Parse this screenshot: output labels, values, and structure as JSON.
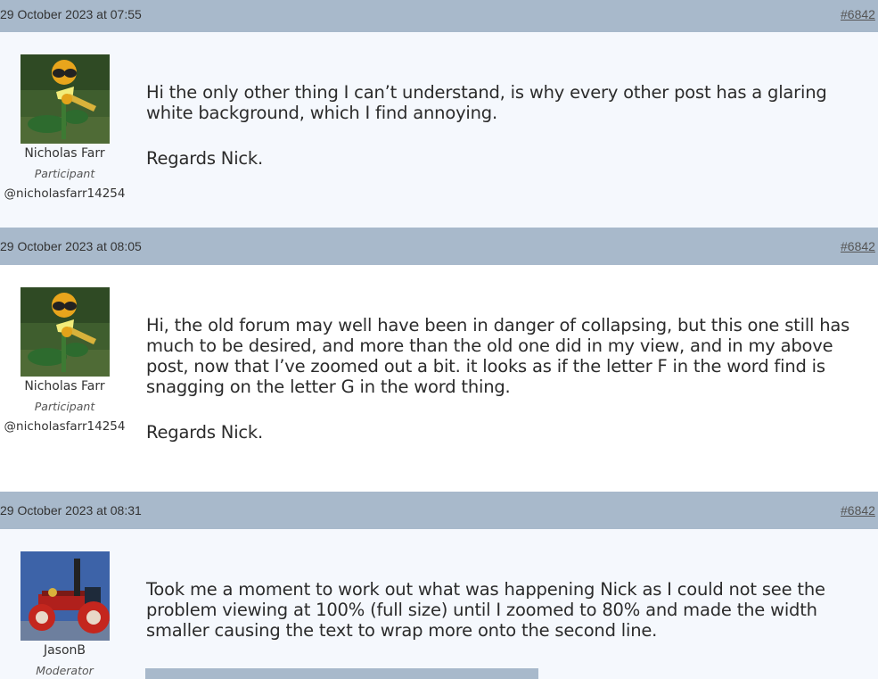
{
  "posts": [
    {
      "date": "29 October 2023 at 07:55",
      "permalink": "#6842",
      "author": {
        "name": "Nicholas Farr",
        "role": "Participant",
        "handle": "@nicholasfarr14254",
        "avatar_icon": "sunflower-avatar"
      },
      "paragraphs": [
        "Hi the only other thing I can’t understand, is why every other post has a glaring white background, which I find annoying.",
        "Regards Nick."
      ]
    },
    {
      "date": "29 October 2023 at 08:05",
      "permalink": "#6842",
      "author": {
        "name": "Nicholas Farr",
        "role": "Participant",
        "handle": "@nicholasfarr14254",
        "avatar_icon": "sunflower-avatar"
      },
      "paragraphs": [
        "Hi, the old forum may well have been in danger of collapsing, but this one still has much to be desired, and more than the old one did in my view, and in my above post, now that I’ve zoomed out a bit. it looks as if the letter F in the word find is snagging on the letter G in the word thing.",
        "Regards Nick."
      ]
    },
    {
      "date": "29 October 2023 at 08:31",
      "permalink": "#6842",
      "author": {
        "name": "JasonB",
        "role": "Moderator",
        "avatar_icon": "traction-engine-avatar"
      },
      "paragraphs": [
        "Took me a moment to work out what was happening Nick as I could not see the problem viewing at 100% (full size) until I zoomed to 80% and made the width smaller causing the text to wrap more onto the second line."
      ]
    }
  ],
  "colors": {
    "header_bg": "#a8b9cb",
    "alt_bg": "#f5f8fd",
    "plain_bg": "#ffffff"
  }
}
